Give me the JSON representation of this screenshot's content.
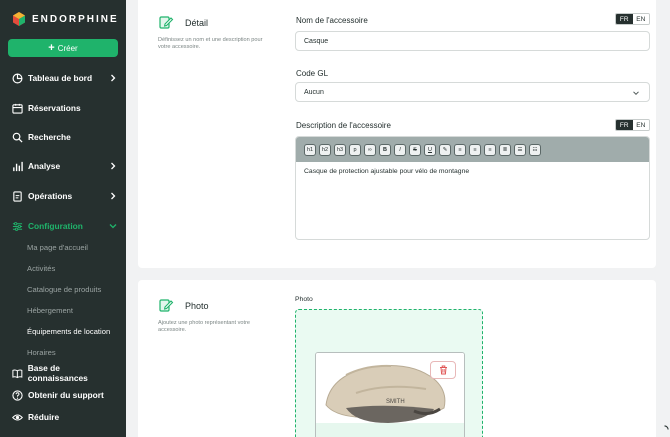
{
  "brand": {
    "name": "ENDORPHINE"
  },
  "sidebar": {
    "create_label": "Créer",
    "items": [
      {
        "label": "Tableau de bord",
        "icon": "dashboard-icon",
        "has_chevron": true
      },
      {
        "label": "Réservations",
        "icon": "calendar-icon",
        "has_chevron": false
      },
      {
        "label": "Recherche",
        "icon": "search-icon",
        "has_chevron": false
      },
      {
        "label": "Analyse",
        "icon": "chart-icon",
        "has_chevron": true
      },
      {
        "label": "Opérations",
        "icon": "operations-icon",
        "has_chevron": true
      },
      {
        "label": "Configuration",
        "icon": "sliders-icon",
        "has_chevron": true
      }
    ],
    "config_subitems": [
      "Ma page d'accueil",
      "Activités",
      "Catalogue de produits",
      "Hébergement",
      "Équipements de location",
      "Horaires"
    ],
    "bottom_items": [
      {
        "label": "Base de connaissances",
        "icon": "book-icon"
      },
      {
        "label": "Obtenir du support",
        "icon": "help-icon"
      },
      {
        "label": "Réduire",
        "icon": "eye-icon"
      }
    ]
  },
  "detail": {
    "title": "Détail",
    "description": "Définissez un nom et une description pour votre accessoire.",
    "name_label": "Nom de l'accessoire",
    "name_value": "Casque",
    "lang_fr": "FR",
    "lang_en": "EN",
    "gl_label": "Code GL",
    "gl_value": "Aucun",
    "desc_label": "Description de l'accessoire",
    "desc_value": "Casque de protection ajustable pour vélo de montagne",
    "toolbar": [
      "h1",
      "h2",
      "h3",
      "p"
    ]
  },
  "photo": {
    "title": "Photo",
    "description": "Ajoutez une photo représentant votre accessoire.",
    "field_label": "Photo",
    "helmet_brand": "SMITH"
  },
  "colors": {
    "sidebar_bg": "#26302f",
    "accent_green": "#1fb36b",
    "toolbar_bg": "#a0acab"
  }
}
